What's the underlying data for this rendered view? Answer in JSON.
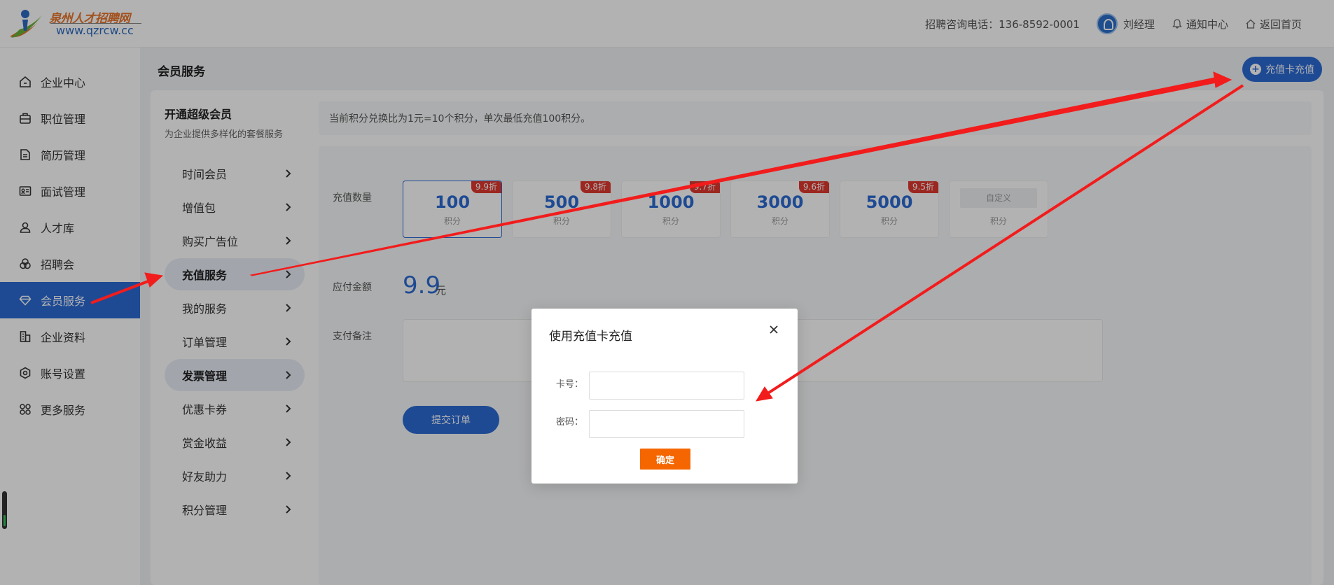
{
  "header": {
    "logo_name": "泉州人才招聘网",
    "logo_url": "www.qzrcw.cc",
    "hotline": "招聘咨询电话：136-8592-0001",
    "user_name": "刘经理",
    "notice": "通知中心",
    "home": "返回首页"
  },
  "sidebar": {
    "items": [
      {
        "label": "企业中心",
        "icon": "home-icon"
      },
      {
        "label": "职位管理",
        "icon": "briefcase-icon"
      },
      {
        "label": "简历管理",
        "icon": "document-icon"
      },
      {
        "label": "面试管理",
        "icon": "id-card-icon"
      },
      {
        "label": "人才库",
        "icon": "person-icon"
      },
      {
        "label": "招聘会",
        "icon": "circles-icon"
      },
      {
        "label": "会员服务",
        "icon": "diamond-icon",
        "active": true
      },
      {
        "label": "企业资料",
        "icon": "building-icon"
      },
      {
        "label": "账号设置",
        "icon": "settings-icon"
      },
      {
        "label": "更多服务",
        "icon": "apps-icon"
      }
    ]
  },
  "main": {
    "page_title": "会员服务",
    "recharge_card_button": "充值卡充值",
    "menu_title": "开通超级会员",
    "menu_subtitle": "为企业提供多样化的套餐服务",
    "menu": [
      {
        "label": "时间会员"
      },
      {
        "label": "增值包"
      },
      {
        "label": "购买广告位"
      },
      {
        "label": "充值服务",
        "active": true
      },
      {
        "label": "我的服务"
      },
      {
        "label": "订单管理"
      },
      {
        "label": "发票管理",
        "active": true
      },
      {
        "label": "优惠卡券"
      },
      {
        "label": "赏金收益"
      },
      {
        "label": "好友助力"
      },
      {
        "label": "积分管理"
      }
    ],
    "notice": "当前积分兑换比为1元=10个积分，单次最低充值100积分。",
    "quantity_label": "充值数量",
    "packages": [
      {
        "amount": "100",
        "unit": "积分",
        "discount": "9.9折",
        "selected": true
      },
      {
        "amount": "500",
        "unit": "积分",
        "discount": "9.8折"
      },
      {
        "amount": "1000",
        "unit": "积分",
        "discount": "9.7折"
      },
      {
        "amount": "3000",
        "unit": "积分",
        "discount": "9.6折"
      },
      {
        "amount": "5000",
        "unit": "积分",
        "discount": "9.5折"
      }
    ],
    "custom_package": {
      "placeholder": "自定义",
      "unit": "积分"
    },
    "amount_label": "应付金额",
    "amount_value": "9.9",
    "amount_unit": "元",
    "remark_label": "支付备注",
    "submit_button": "提交订单"
  },
  "modal": {
    "title": "使用充值卡充值",
    "card_label": "卡号：",
    "password_label": "密码：",
    "confirm_button": "确定"
  },
  "colors": {
    "primary": "#2b6bd4",
    "badge": "#e0392f",
    "confirm": "#f56600",
    "annotation_arrow": "#f21c1c"
  }
}
